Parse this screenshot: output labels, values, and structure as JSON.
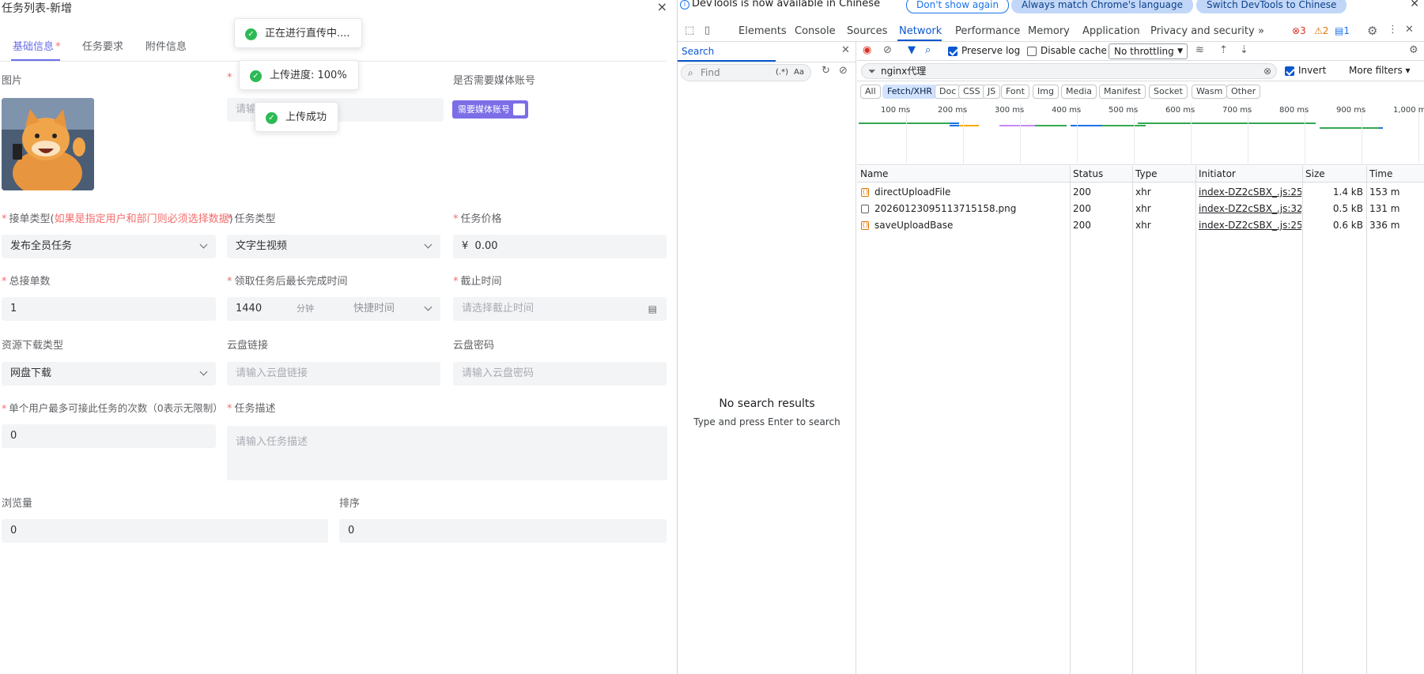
{
  "left": {
    "title": "任务列表-新增",
    "close": "×",
    "tabs": [
      {
        "label": "基础信息",
        "required": "*",
        "active": true
      },
      {
        "label": "任务要求",
        "required": "",
        "active": false
      },
      {
        "label": "附件信息",
        "required": "",
        "active": false
      }
    ],
    "toasts": [
      {
        "text": "正在进行直传中...."
      },
      {
        "text": "上传进度: 100%"
      },
      {
        "text": "上传成功"
      }
    ],
    "fields": {
      "image_label": "图片",
      "name_placeholder": "请输",
      "media_label": "是否需要媒体账号",
      "media_toggle": "需要媒体账号",
      "order_type_label_main": "接单类型(",
      "order_type_label_red": "如果是指定用户和部门则必须选择数据",
      "order_type_label_end": ")",
      "order_type_value": "发布全员任务",
      "task_type_label": "任务类型",
      "task_type_value": "文字生视频",
      "price_label": "任务价格",
      "price_symbol": "¥",
      "price_value": "0.00",
      "total_label": "总接单数",
      "total_value": "1",
      "max_time_label": "领取任务后最长完成时间",
      "max_time_value": "1440",
      "max_time_unit": "分钟",
      "quick_time": "快捷时间",
      "deadline_label": "截止时间",
      "deadline_placeholder": "请选择截止时间",
      "download_type_label": "资源下载类型",
      "download_type_value": "网盘下载",
      "cloud_link_label": "云盘链接",
      "cloud_link_placeholder": "请输入云盘链接",
      "cloud_pwd_label": "云盘密码",
      "cloud_pwd_placeholder": "请输入云盘密码",
      "max_per_user_label": "单个用户最多可接此任务的次数（0表示无限制）",
      "max_per_user_value": "0",
      "desc_label": "任务描述",
      "desc_placeholder": "请输入任务描述",
      "views_label": "浏览量",
      "views_value": "0",
      "sort_label": "排序",
      "sort_value": "0"
    },
    "required_mark": "*"
  },
  "devtools": {
    "lang_message": "DevTools is now available in Chinese",
    "btn_dont_show": "Don't show again",
    "btn_always_match": "Always match Chrome's language",
    "btn_switch": "Switch DevTools to Chinese",
    "tabs": [
      "Elements",
      "Console",
      "Sources",
      "Network",
      "Performance",
      "Memory",
      "Application",
      "Privacy and security"
    ],
    "active_tab": "Network",
    "more_tabs": "»",
    "errors": "3",
    "warnings": "2",
    "infos": "1",
    "search": {
      "tab": "Search",
      "find_placeholder": "Find",
      "regex": "(.*)",
      "case": "Aa",
      "no_results": "No search results",
      "no_results_sub": "Type and press Enter to search"
    },
    "network": {
      "preserve_log": "Preserve log",
      "disable_cache": "Disable cache",
      "throttling": "No throttling",
      "filter_value": "nginx代理",
      "invert": "Invert",
      "more_filters": "More filters",
      "chips": [
        "All",
        "Fetch/XHR",
        "Doc",
        "CSS",
        "JS",
        "Font",
        "Img",
        "Media",
        "Manifest",
        "Socket",
        "Wasm",
        "Other"
      ],
      "active_chip": "Fetch/XHR",
      "timeline_ticks": [
        "100 ms",
        "200 ms",
        "300 ms",
        "400 ms",
        "500 ms",
        "600 ms",
        "700 ms",
        "800 ms",
        "900 ms",
        "1,000 ms"
      ],
      "columns": [
        "Name",
        "Status",
        "Type",
        "Initiator",
        "Size",
        "Time"
      ],
      "rows": [
        {
          "name": "directUploadFile",
          "status": "200",
          "type": "xhr",
          "initiator": "index-DZ2cSBX_.js:252",
          "size": "1.4 kB",
          "time": "153 m",
          "icon": "xhr-icon"
        },
        {
          "name": "20260123095113715158.png",
          "status": "200",
          "type": "xhr",
          "initiator": "index-DZ2cSBX_.js:325",
          "size": "0.5 kB",
          "time": "131 m",
          "icon": "doc-icon"
        },
        {
          "name": "saveUploadBase",
          "status": "200",
          "type": "xhr",
          "initiator": "index-DZ2cSBX_.js:252",
          "size": "0.6 kB",
          "time": "336 m",
          "icon": "xhr-icon"
        }
      ]
    }
  },
  "colors": {
    "accent": "#6a6ee8",
    "required": "#f56c6c",
    "success": "#2dba55",
    "devtools_blue": "#0b57d0"
  }
}
